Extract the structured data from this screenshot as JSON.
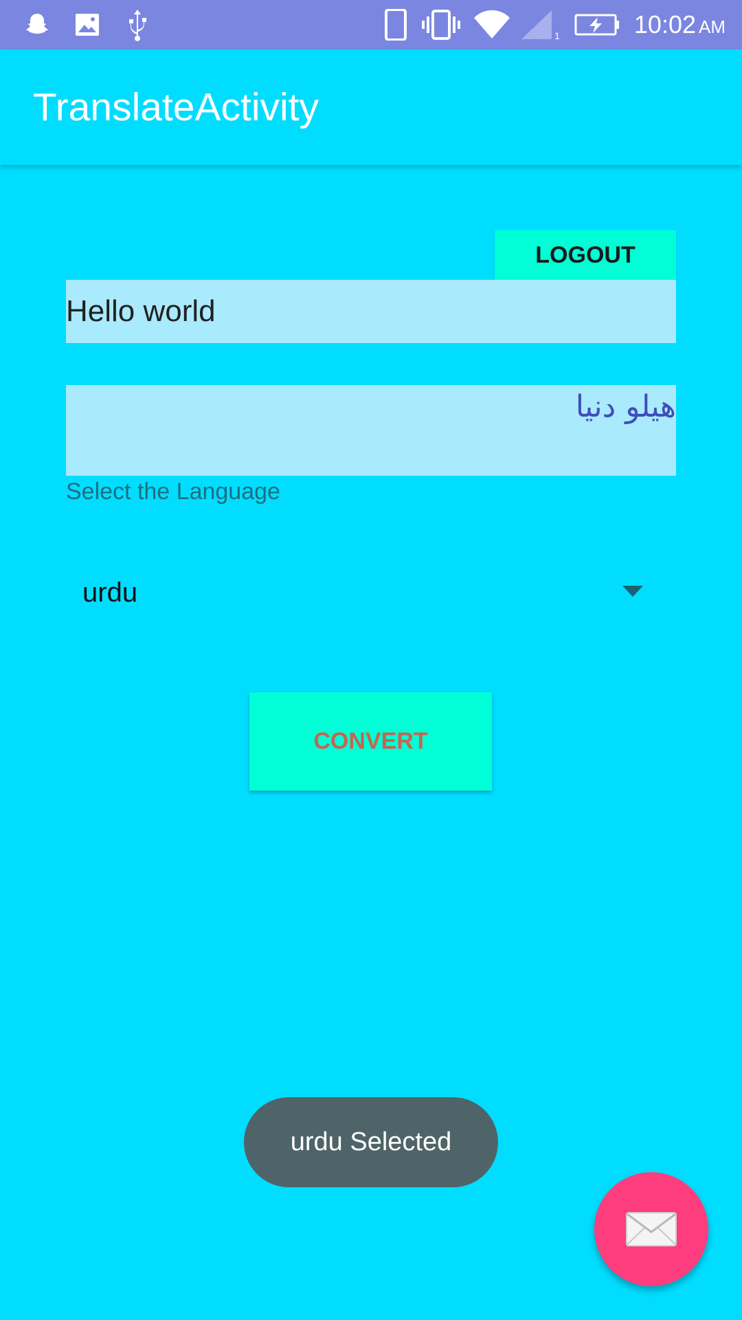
{
  "status_bar": {
    "time": "10:02",
    "ampm": "AM",
    "left_icons": [
      "snapchat-icon",
      "image-icon",
      "usb-icon"
    ],
    "right_icons": [
      "phone-icon",
      "vibrate-icon",
      "wifi-icon",
      "signal-icon",
      "battery-charging-icon"
    ],
    "signal_sim_label": "1"
  },
  "app_bar": {
    "title": "TranslateActivity"
  },
  "logout": {
    "label": "LOGOUT"
  },
  "input": {
    "value": "Hello world"
  },
  "output": {
    "value": "هیلو دنیا"
  },
  "language": {
    "label": "Select the Language",
    "selected": "urdu"
  },
  "convert": {
    "label": "CONVERT"
  },
  "toast": {
    "message": "urdu Selected"
  },
  "fab": {
    "icon": "envelope-icon"
  },
  "colors": {
    "background": "#00DDFF",
    "status_bar": "#7B86E0",
    "button": "#00FFD6",
    "field": "#A9EAFD",
    "fab": "#FE3D7E",
    "toast": "#4F6468",
    "convert_text": "#C46650"
  }
}
